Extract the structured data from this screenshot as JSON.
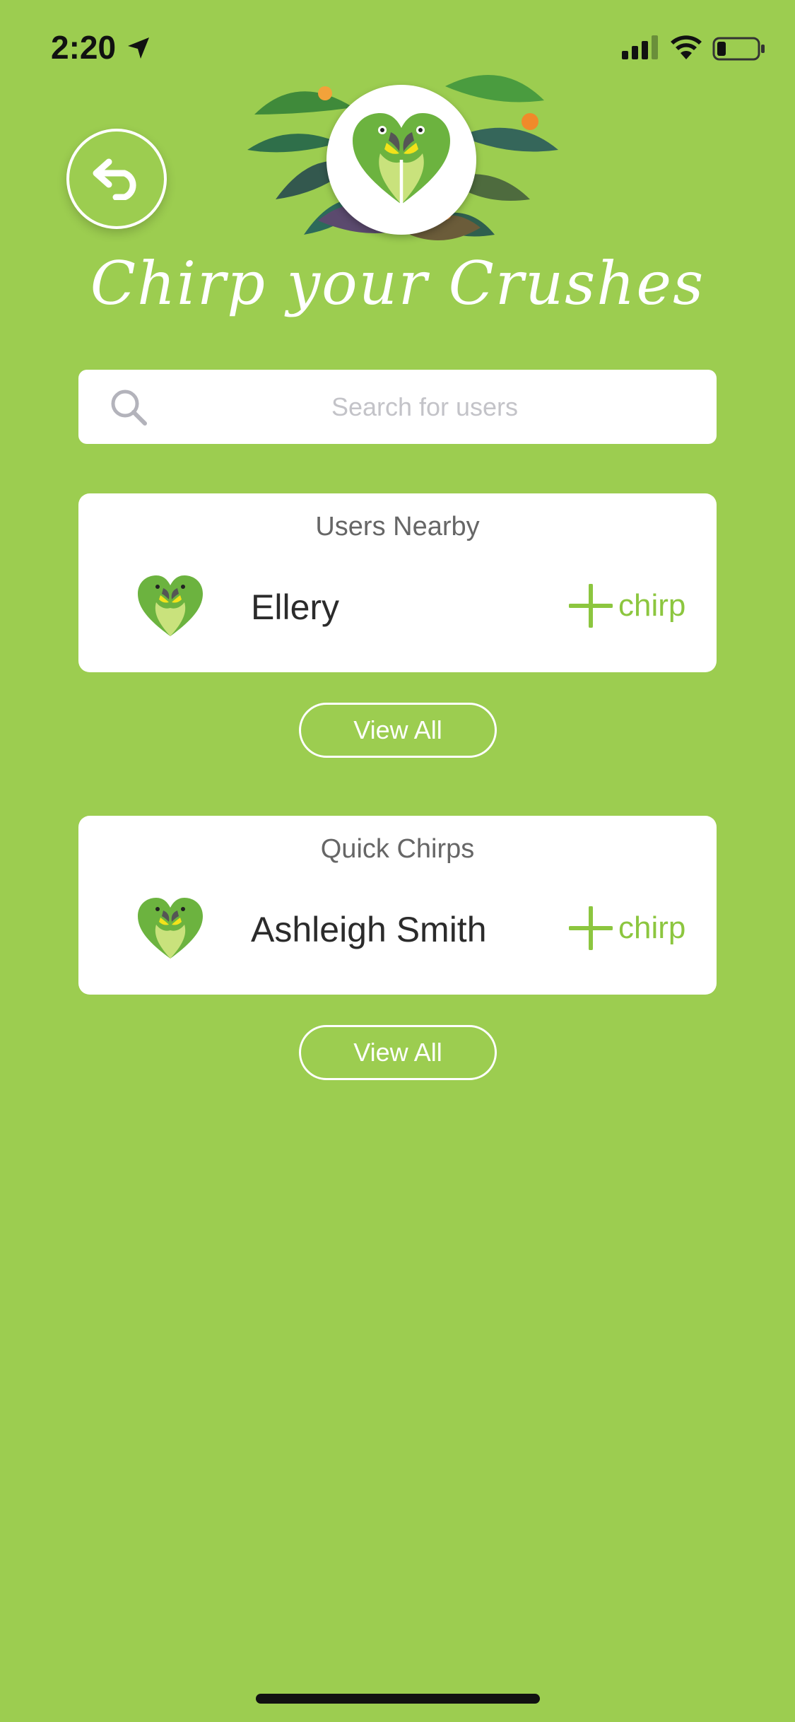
{
  "status_bar": {
    "time": "2:20"
  },
  "header": {
    "title": "Chirp your Crushes"
  },
  "search": {
    "placeholder": "Search for users"
  },
  "users_nearby": {
    "title": "Users Nearby",
    "users": [
      {
        "name": "Ellery",
        "action_label": "chirp"
      }
    ],
    "view_all_label": "View All"
  },
  "quick_chirps": {
    "title": "Quick Chirps",
    "users": [
      {
        "name": "Ashleigh Smith",
        "action_label": "chirp"
      }
    ],
    "view_all_label": "View All"
  },
  "colors": {
    "background": "#9ccd50",
    "accent": "#8cc63f",
    "card": "#ffffff",
    "text_dark": "#2b2b2b",
    "text_muted": "#666666"
  },
  "icons": [
    "location-arrow-icon",
    "signal-icon",
    "wifi-icon",
    "battery-icon",
    "back-arrow-icon",
    "parrot-logo-icon",
    "search-icon",
    "plus-icon"
  ]
}
